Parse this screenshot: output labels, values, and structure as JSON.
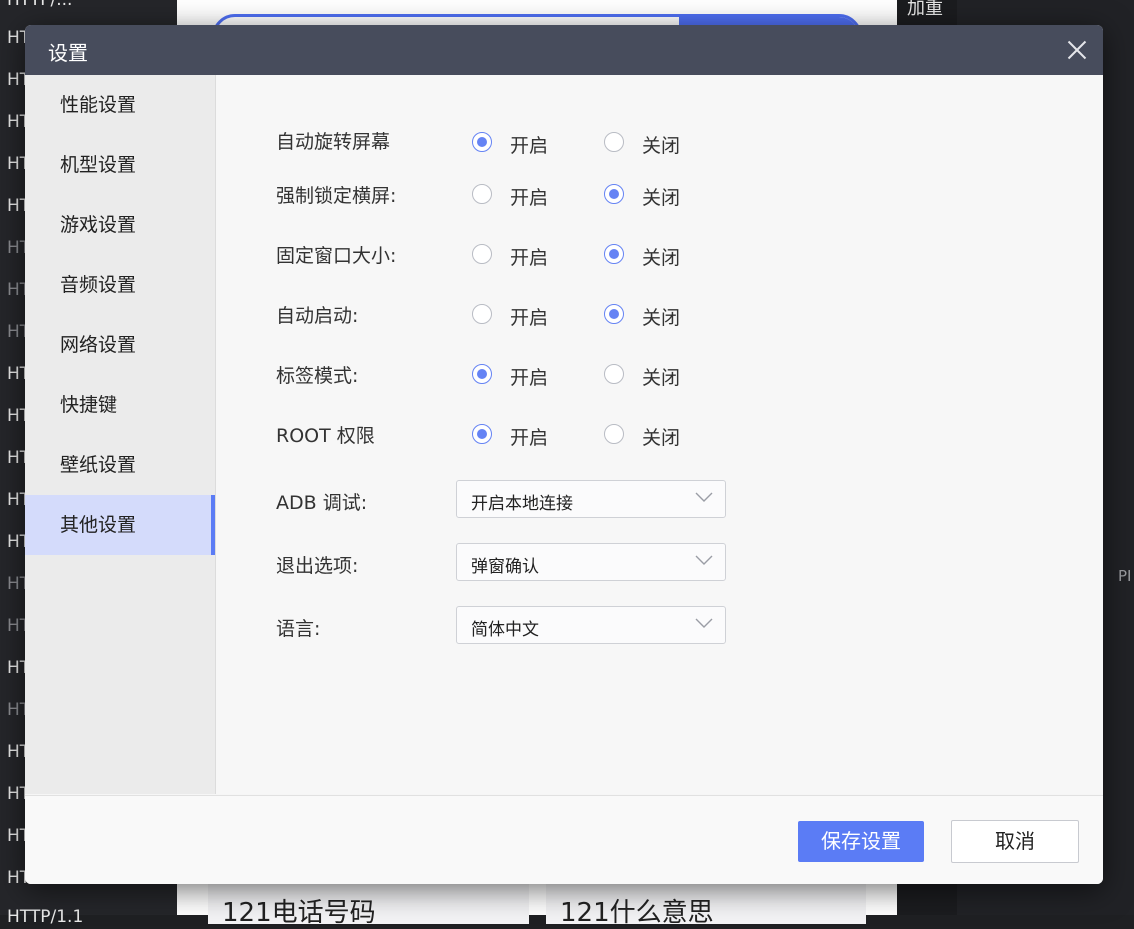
{
  "background": {
    "left_items": [
      {
        "text": "HTTP/...",
        "dim": false
      },
      {
        "text": "HT",
        "dim": false
      },
      {
        "text": "HT",
        "dim": false
      },
      {
        "text": "HT",
        "dim": false
      },
      {
        "text": "HT",
        "dim": false
      },
      {
        "text": "HT",
        "dim": false
      },
      {
        "text": "HT",
        "dim": true
      },
      {
        "text": "HT",
        "dim": true
      },
      {
        "text": "HT",
        "dim": true
      },
      {
        "text": "HT",
        "dim": false
      },
      {
        "text": "HT",
        "dim": false
      },
      {
        "text": "HT",
        "dim": false
      },
      {
        "text": "HT",
        "dim": false
      },
      {
        "text": "HT",
        "dim": false
      },
      {
        "text": "HT",
        "dim": true
      },
      {
        "text": "HT",
        "dim": true
      },
      {
        "text": "HT",
        "dim": false
      },
      {
        "text": "HT",
        "dim": true
      },
      {
        "text": "HT",
        "dim": false
      },
      {
        "text": "HT",
        "dim": false
      },
      {
        "text": "HT",
        "dim": false
      },
      {
        "text": "HT",
        "dim": false
      },
      {
        "text": "HTTP/1.1",
        "dim": false
      }
    ],
    "card_left": "121电话号码",
    "card_right": "121什么意思",
    "right_top": "加重",
    "right_pi": "PI"
  },
  "dialog": {
    "title": "设置",
    "sidebar": [
      {
        "label": "性能设置",
        "active": false
      },
      {
        "label": "机型设置",
        "active": false
      },
      {
        "label": "游戏设置",
        "active": false
      },
      {
        "label": "音频设置",
        "active": false
      },
      {
        "label": "网络设置",
        "active": false
      },
      {
        "label": "快捷键",
        "active": false
      },
      {
        "label": "壁纸设置",
        "active": false
      },
      {
        "label": "其他设置",
        "active": true
      }
    ],
    "radio_on_label": "开启",
    "radio_off_label": "关闭",
    "radio_rows": [
      {
        "label": "自动旋转屏幕",
        "value": "on"
      },
      {
        "label": "强制锁定横屏:",
        "value": "off"
      },
      {
        "label": "固定窗口大小:",
        "value": "off"
      },
      {
        "label": "自动启动:",
        "value": "off"
      },
      {
        "label": "标签模式:",
        "value": "on"
      },
      {
        "label": "ROOT 权限",
        "value": "on"
      }
    ],
    "selects": [
      {
        "label": "ADB 调试:",
        "value": "开启本地连接"
      },
      {
        "label": "退出选项:",
        "value": "弹窗确认"
      },
      {
        "label": "语言:",
        "value": "简体中文"
      }
    ],
    "buttons": {
      "save": "保存设置",
      "cancel": "取消"
    },
    "colors": {
      "accent": "#5b7cf5",
      "titlebar": "#474c5c",
      "active_item_bg": "#d4dbfb"
    }
  }
}
